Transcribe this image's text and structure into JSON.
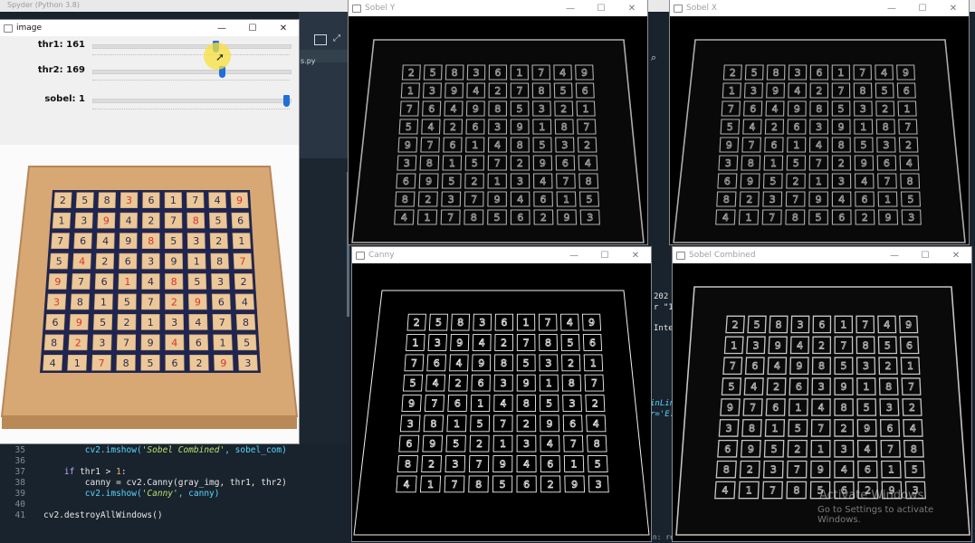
{
  "spyder": {
    "title": "Spyder (Python 3.8)",
    "file_tab_fragment": "s.py",
    "console_fragments": [
      "202",
      "r \"1",
      "Inte",
      "inLine",
      "r='E:",
      "in: rea"
    ],
    "code_lines": [
      {
        "n": "35",
        "indent": "        ",
        "parts": [
          [
            "fn",
            "cv2.imshow("
          ],
          [
            "str",
            "'Sobel Combined'"
          ],
          [
            "fn",
            ", sobel_com)"
          ]
        ]
      },
      {
        "n": "36",
        "indent": "",
        "parts": []
      },
      {
        "n": "37",
        "indent": "    ",
        "parts": [
          [
            "kw",
            "if"
          ],
          [
            "txt",
            " thr1 > "
          ],
          [
            "num",
            "1"
          ],
          [
            "txt",
            ":"
          ]
        ]
      },
      {
        "n": "38",
        "indent": "        ",
        "parts": [
          [
            "txt",
            "canny = cv2.Canny(gray_img, thr1, thr2)"
          ]
        ]
      },
      {
        "n": "39",
        "indent": "        ",
        "parts": [
          [
            "fn",
            "cv2.imshow("
          ],
          [
            "str",
            "'Canny'"
          ],
          [
            "fn",
            ", canny)"
          ]
        ]
      },
      {
        "n": "40",
        "indent": "",
        "parts": []
      },
      {
        "n": "41",
        "indent": "",
        "parts": [
          [
            "txt",
            "cv2.destroyAllWindows()"
          ]
        ]
      }
    ]
  },
  "windows": {
    "image": {
      "title": "image"
    },
    "sobel_y": {
      "title": "Sobel Y"
    },
    "sobel_x": {
      "title": "Sobel X"
    },
    "canny": {
      "title": "Canny"
    },
    "sobel_combined": {
      "title": "Sobel Combined"
    }
  },
  "window_controls": {
    "minimize": "—",
    "maximize": "☐",
    "close": "✕"
  },
  "trackbars": [
    {
      "label": "thr1: 161",
      "value": 161,
      "max": 255
    },
    {
      "label": "thr2: 169",
      "value": 169,
      "max": 255
    },
    {
      "label": "sobel: 1",
      "value": 1,
      "max": 1
    }
  ],
  "sudoku": {
    "grid": [
      [
        2,
        5,
        8,
        3,
        6,
        1,
        7,
        4,
        9
      ],
      [
        1,
        3,
        9,
        4,
        2,
        7,
        8,
        5,
        6
      ],
      [
        7,
        6,
        4,
        9,
        8,
        5,
        3,
        2,
        1
      ],
      [
        5,
        4,
        2,
        6,
        3,
        9,
        1,
        8,
        7
      ],
      [
        9,
        7,
        6,
        1,
        4,
        8,
        5,
        3,
        2
      ],
      [
        3,
        8,
        1,
        5,
        7,
        2,
        9,
        6,
        4
      ],
      [
        6,
        9,
        5,
        2,
        1,
        3,
        4,
        7,
        8
      ],
      [
        8,
        2,
        3,
        7,
        9,
        4,
        6,
        1,
        5
      ],
      [
        4,
        1,
        7,
        8,
        5,
        6,
        2,
        9,
        3
      ]
    ],
    "red_cells": [
      "0,3",
      "0,8",
      "1,2",
      "1,6",
      "2,4",
      "3,1",
      "3,8",
      "4,0",
      "4,3",
      "4,5",
      "5,0",
      "5,5",
      "5,6",
      "6,1",
      "7,1",
      "7,5",
      "8,2",
      "8,7"
    ]
  },
  "watermark": {
    "line1": "Activate Windows",
    "line2": "Go to Settings to activate Windows."
  }
}
